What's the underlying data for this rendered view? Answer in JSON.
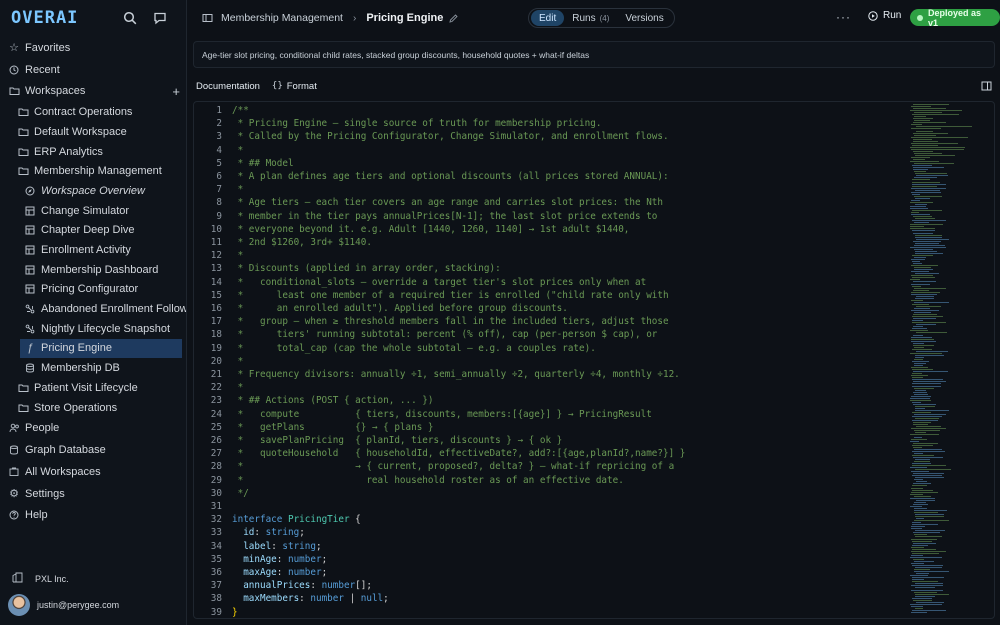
{
  "app": {
    "logo": "OVERAI"
  },
  "sidebar": {
    "top_items": [
      {
        "label": "Favorites",
        "icon": "star-icon"
      },
      {
        "label": "Recent",
        "icon": "clock-icon"
      },
      {
        "label": "Workspaces",
        "icon": "folder-icon"
      }
    ],
    "workspaces": [
      {
        "label": "Contract Operations"
      },
      {
        "label": "Default Workspace"
      },
      {
        "label": "ERP Analytics"
      },
      {
        "label": "Membership Management"
      }
    ],
    "membership_children": [
      {
        "label": "Workspace Overview",
        "icon": "compass-icon"
      },
      {
        "label": "Change Simulator",
        "icon": "grid-icon"
      },
      {
        "label": "Chapter Deep Dive",
        "icon": "grid-icon"
      },
      {
        "label": "Enrollment Activity",
        "icon": "grid-icon"
      },
      {
        "label": "Membership Dashboard",
        "icon": "grid-icon"
      },
      {
        "label": "Pricing Configurator",
        "icon": "grid-icon"
      },
      {
        "label": "Abandoned Enrollment Follow-u...",
        "icon": "workflow-icon"
      },
      {
        "label": "Nightly Lifecycle Snapshot",
        "icon": "workflow-icon"
      },
      {
        "label": "Pricing Engine",
        "icon": "function-icon"
      },
      {
        "label": "Membership DB",
        "icon": "database-icon"
      }
    ],
    "more_workspaces": [
      {
        "label": "Patient Visit Lifecycle"
      },
      {
        "label": "Store Operations"
      }
    ],
    "bottom_items": [
      {
        "label": "People",
        "icon": "people-icon"
      },
      {
        "label": "Graph Database",
        "icon": "database-icon"
      },
      {
        "label": "All Workspaces",
        "icon": "workspaces-icon"
      },
      {
        "label": "Settings",
        "icon": "gear-icon"
      },
      {
        "label": "Help",
        "icon": "help-icon"
      }
    ],
    "org": "PXL Inc.",
    "user": "justin@perygee.com"
  },
  "header": {
    "breadcrumb": "Membership Management",
    "title": "Pricing Engine",
    "tabs": [
      {
        "label": "Edit",
        "active": true
      },
      {
        "label": "Runs",
        "count": "(4)"
      },
      {
        "label": "Versions"
      }
    ],
    "run_label": "Run",
    "deployed_label": "Deployed as v1"
  },
  "description": "Age-tier slot pricing, conditional child rates, stacked group discounts, household quotes + what-if deltas",
  "editor_tabs": {
    "documentation": "Documentation",
    "format": "Format",
    "format_icon": "{}"
  },
  "code": {
    "lines": [
      {
        "n": "1",
        "s": [
          [
            "c",
            "/**"
          ]
        ]
      },
      {
        "n": "2",
        "s": [
          [
            "c",
            " * Pricing Engine — single source of truth for membership pricing."
          ]
        ]
      },
      {
        "n": "3",
        "s": [
          [
            "c",
            " * Called by the Pricing Configurator, Change Simulator, and enrollment flows."
          ]
        ]
      },
      {
        "n": "4",
        "s": [
          [
            "c",
            " *"
          ]
        ]
      },
      {
        "n": "5",
        "s": [
          [
            "c",
            " * ## Model"
          ]
        ]
      },
      {
        "n": "6",
        "s": [
          [
            "c",
            " * A plan defines age tiers and optional discounts (all prices stored ANNUAL):"
          ]
        ]
      },
      {
        "n": "7",
        "s": [
          [
            "c",
            " *"
          ]
        ]
      },
      {
        "n": "8",
        "s": [
          [
            "c",
            " * Age tiers — each tier covers an age range and carries slot prices: the Nth"
          ]
        ]
      },
      {
        "n": "9",
        "s": [
          [
            "c",
            " * member in the tier pays annualPrices[N-1]; the last slot price extends to"
          ]
        ]
      },
      {
        "n": "10",
        "s": [
          [
            "c",
            " * everyone beyond it. e.g. Adult [1440, 1260, 1140] → 1st adult $1440,"
          ]
        ]
      },
      {
        "n": "11",
        "s": [
          [
            "c",
            " * 2nd $1260, 3rd+ $1140."
          ]
        ]
      },
      {
        "n": "12",
        "s": [
          [
            "c",
            " *"
          ]
        ]
      },
      {
        "n": "13",
        "s": [
          [
            "c",
            " * Discounts (applied in array order, stacking):"
          ]
        ]
      },
      {
        "n": "14",
        "s": [
          [
            "c",
            " *   conditional_slots — override a target tier's slot prices only when at"
          ]
        ]
      },
      {
        "n": "15",
        "s": [
          [
            "c",
            " *      least one member of a required tier is enrolled (\"child rate only with"
          ]
        ]
      },
      {
        "n": "16",
        "s": [
          [
            "c",
            " *      an enrolled adult\"). Applied before group discounts."
          ]
        ]
      },
      {
        "n": "17",
        "s": [
          [
            "c",
            " *   group — when ≥ threshold members fall in the included tiers, adjust those"
          ]
        ]
      },
      {
        "n": "18",
        "s": [
          [
            "c",
            " *      tiers' running subtotal: percent (% off), cap (per-person $ cap), or"
          ]
        ]
      },
      {
        "n": "19",
        "s": [
          [
            "c",
            " *      total_cap (cap the whole subtotal — e.g. a couples rate)."
          ]
        ]
      },
      {
        "n": "20",
        "s": [
          [
            "c",
            " *"
          ]
        ]
      },
      {
        "n": "21",
        "s": [
          [
            "c",
            " * Frequency divisors: annually ÷1, semi_annually ÷2, quarterly ÷4, monthly ÷12."
          ]
        ]
      },
      {
        "n": "22",
        "s": [
          [
            "c",
            " *"
          ]
        ]
      },
      {
        "n": "23",
        "s": [
          [
            "c",
            " * ## Actions (POST { action, ... })"
          ]
        ]
      },
      {
        "n": "24",
        "s": [
          [
            "c",
            " *   compute          { tiers, discounts, members:[{age}] } → PricingResult"
          ]
        ]
      },
      {
        "n": "25",
        "s": [
          [
            "c",
            " *   getPlans         {} → { plans }"
          ]
        ]
      },
      {
        "n": "26",
        "s": [
          [
            "c",
            " *   savePlanPricing  { planId, tiers, discounts } → { ok }"
          ]
        ]
      },
      {
        "n": "27",
        "s": [
          [
            "c",
            " *   quoteHousehold   { householdId, effectiveDate?, add?:[{age,planId?,name?}] }"
          ]
        ]
      },
      {
        "n": "28",
        "s": [
          [
            "c",
            " *                    → { current, proposed?, delta? } — what-if repricing of a"
          ]
        ]
      },
      {
        "n": "29",
        "s": [
          [
            "c",
            " *                      real household roster as of an effective date."
          ]
        ]
      },
      {
        "n": "30",
        "s": [
          [
            "c",
            " */"
          ]
        ]
      },
      {
        "n": "31",
        "s": []
      },
      {
        "n": "32",
        "s": [
          [
            "k",
            "interface "
          ],
          [
            "t",
            "PricingTier"
          ],
          [
            "p",
            " {"
          ]
        ]
      },
      {
        "n": "33",
        "s": [
          [
            "pr",
            "  id"
          ],
          [
            "p",
            ": "
          ],
          [
            "k",
            "string"
          ],
          [
            "p",
            ";"
          ]
        ]
      },
      {
        "n": "34",
        "s": [
          [
            "pr",
            "  label"
          ],
          [
            "p",
            ": "
          ],
          [
            "k",
            "string"
          ],
          [
            "p",
            ";"
          ]
        ]
      },
      {
        "n": "35",
        "s": [
          [
            "pr",
            "  minAge"
          ],
          [
            "p",
            ": "
          ],
          [
            "k",
            "number"
          ],
          [
            "p",
            ";"
          ]
        ]
      },
      {
        "n": "36",
        "s": [
          [
            "pr",
            "  maxAge"
          ],
          [
            "p",
            ": "
          ],
          [
            "k",
            "number"
          ],
          [
            "p",
            ";"
          ]
        ]
      },
      {
        "n": "37",
        "s": [
          [
            "pr",
            "  annualPrices"
          ],
          [
            "p",
            ": "
          ],
          [
            "k",
            "number"
          ],
          [
            "p",
            "[];"
          ]
        ]
      },
      {
        "n": "38",
        "s": [
          [
            "pr",
            "  maxMembers"
          ],
          [
            "p",
            ": "
          ],
          [
            "k",
            "number"
          ],
          [
            "p",
            " | "
          ],
          [
            "k",
            "null"
          ],
          [
            "p",
            ";"
          ]
        ]
      },
      {
        "n": "39",
        "s": [
          [
            "y",
            "}"
          ]
        ]
      }
    ]
  },
  "colors": {
    "accent": "#7cc7ff",
    "deployed": "#2ea043",
    "active_nav": "#1e3a5f",
    "comment": "#6a9955",
    "keyword": "#569cd6"
  }
}
